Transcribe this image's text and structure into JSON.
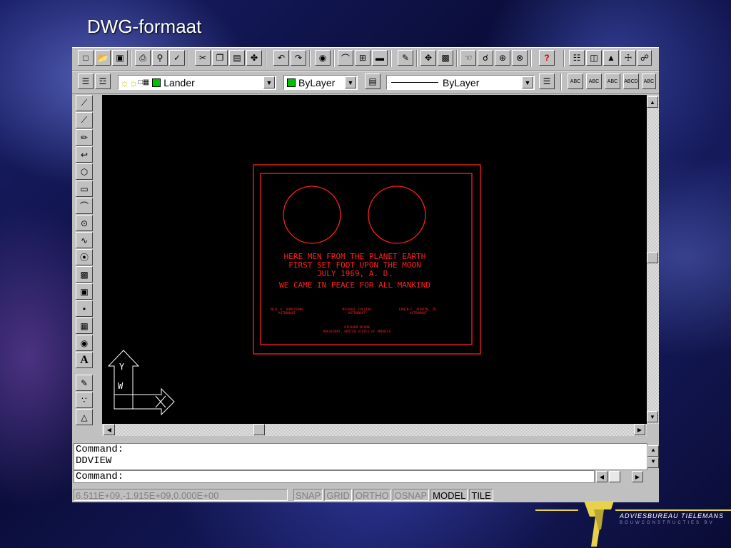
{
  "slide": {
    "title": "DWG-formaat"
  },
  "toolbar": {
    "icons": [
      "new-icon",
      "open-icon",
      "save-icon",
      "print-icon",
      "print-preview-icon",
      "spelling-icon",
      "cut-icon",
      "copy-icon",
      "paste-icon",
      "match-properties-icon",
      "undo-icon",
      "redo-icon",
      "launch-browser-icon",
      "object-snap-icon",
      "ucs-icon",
      "inquiry-icon",
      "redraw-icon",
      "pan-icon",
      "aerial-view-icon",
      "zoom-realtime-icon",
      "zoom-window-icon",
      "zoom-previous-icon",
      "help-icon",
      "properties-icon",
      "dimension-icon",
      "attribute-icon",
      "block-icon",
      "external-reference-icon"
    ]
  },
  "layers": {
    "layer_name": "Lander",
    "color_value": "ByLayer",
    "linetype_value": "ByLayer"
  },
  "drawing": {
    "line1": "HERE MEN FROM THE PLANET EARTH",
    "line2": "FIRST SET FOOT UPON THE MOON",
    "line3": "JULY 1969, A. D.",
    "line4": "WE CAME IN PEACE FOR ALL MANKIND",
    "sig1_name": "NEIL A. ARMSTRONG",
    "sig1_title": "ASTRONAUT",
    "sig2_name": "MICHAEL COLLINS",
    "sig2_title": "ASTRONAUT",
    "sig3_name": "EDWIN E. ALDRIN, JR.",
    "sig3_title": "ASTRONAUT",
    "sig4_name": "RICHARD NIXON",
    "sig4_title": "PRESIDENT, UNITED STATES OF AMERICA",
    "ucs_y": "Y",
    "ucs_w": "W",
    "color": "#ff2020"
  },
  "command": {
    "history1": "Command:",
    "history2": "DDVIEW",
    "prompt": "Command:"
  },
  "status": {
    "coords": "6.511E+09,-1.915E+09,0.000E+00",
    "snap": "SNAP",
    "grid": "GRID",
    "ortho": "ORTHO",
    "osnap": "OSNAP",
    "model": "MODEL",
    "tile": "TILE"
  },
  "logo": {
    "company": "ADVIESBUREAU TIELEMANS",
    "tagline": "BOUWCONSTRUCTIES BV"
  }
}
